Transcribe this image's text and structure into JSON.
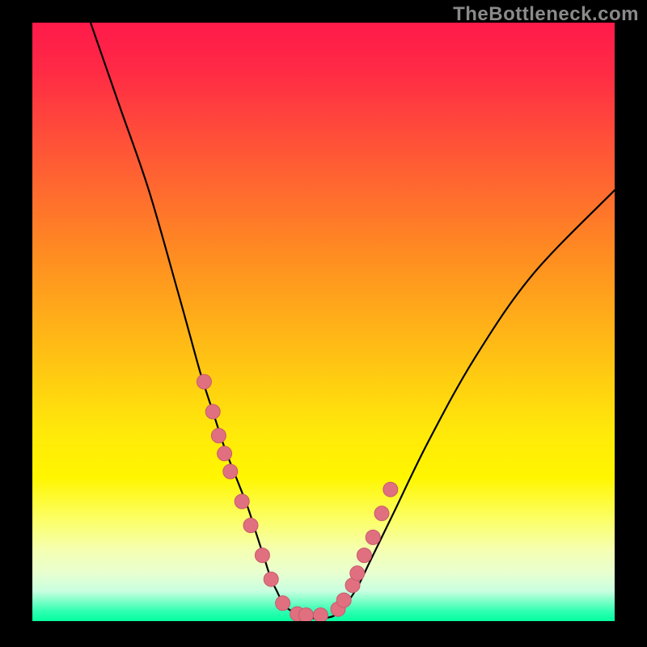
{
  "watermark": "TheBottleneck.com",
  "colors": {
    "curve_stroke": "#000000",
    "marker_fill": "#e07080",
    "marker_stroke": "#c85a6a",
    "background": "#000000"
  },
  "chart_data": {
    "type": "line",
    "title": "",
    "xlabel": "",
    "ylabel": "",
    "xlim": [
      0,
      100
    ],
    "ylim": [
      0,
      100
    ],
    "grid": false,
    "legend": false,
    "note": "No axis labels or tick marks are present; values are pixel-estimated percentages of plotting area width/height.",
    "series": [
      {
        "name": "curve",
        "x": [
          10,
          15,
          20,
          25,
          27,
          29,
          31,
          33,
          35,
          37,
          38,
          39,
          40,
          41,
          42,
          43,
          44,
          46,
          48,
          50,
          52,
          54,
          56,
          58,
          62,
          68,
          76,
          86,
          100
        ],
        "y": [
          100,
          86,
          72,
          55,
          48,
          41,
          35,
          29,
          24,
          19,
          16,
          13,
          10,
          7,
          5,
          3,
          2,
          1,
          0.5,
          0.5,
          1,
          3,
          6,
          10,
          18,
          30,
          44,
          58,
          72
        ]
      }
    ],
    "markers": {
      "name": "highlight-points",
      "x": [
        29.5,
        31,
        32,
        33,
        34,
        36,
        37.5,
        39.5,
        41,
        43,
        45.5,
        47,
        49.5,
        52.5,
        53.5,
        55,
        55.8,
        57,
        58.5,
        60,
        61.5
      ],
      "y": [
        40,
        35,
        31,
        28,
        25,
        20,
        16,
        11,
        7,
        3,
        1.2,
        1,
        1,
        2,
        3.5,
        6,
        8,
        11,
        14,
        18,
        22
      ]
    }
  }
}
